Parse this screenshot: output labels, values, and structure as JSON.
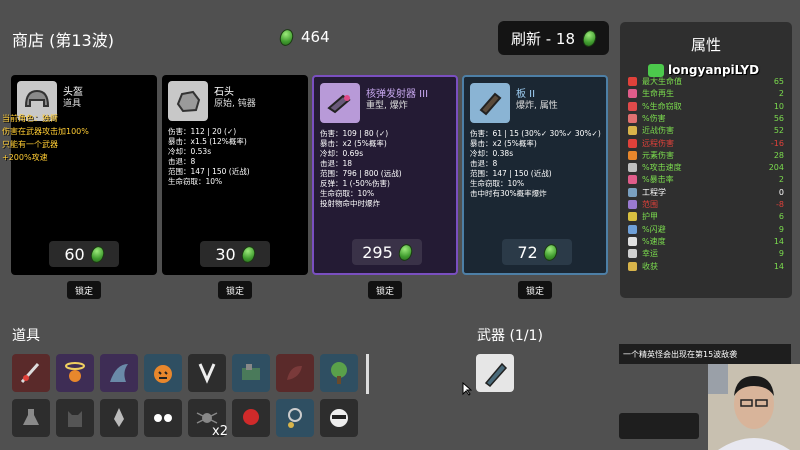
{
  "shop_title": "商店 (第13波)",
  "coins": "464",
  "refresh_label": "刷新 - 18",
  "cards": [
    {
      "name": "头盔",
      "type": "道具",
      "price": "60",
      "lock": "锁定",
      "stats": []
    },
    {
      "name": "石头",
      "type": "原始, 钝器",
      "price": "30",
      "lock": "锁定",
      "stats": [
        "伤害：112 | 20 (✓)",
        "暴击：x1.5 (12%概率)",
        "冷却：0.53s",
        "击退：8",
        "范围：147 | 150 (近战)",
        "生命窃取：10%"
      ]
    },
    {
      "name": "核弹发射器 III",
      "type": "重型, 爆炸",
      "price": "295",
      "lock": "锁定",
      "stats": [
        "伤害：109 | 80 (✓)",
        "暴击：x2 (5%概率)",
        "冷却：0.69s",
        "击退：18",
        "范围：796 | 800 (远战)",
        "反弹：1 (-50%伤害)",
        "生命窃取：10%",
        "投射物命中时爆炸"
      ]
    },
    {
      "name": "板 II",
      "type": "爆炸, 属性",
      "price": "72",
      "lock": "锁定",
      "stats": [
        "伤害：61 | 15 (30%✓ 30%✓ 30%✓)",
        "暴击：x2 (5%概率)",
        "冷却：0.38s",
        "击退：8",
        "范围：147 | 150 (近战)",
        "生命窃取：10%",
        "击中时有30%概率爆炸"
      ]
    }
  ],
  "items_title": "道具",
  "items_extra_count": "x2",
  "weapons_title": "武器 (1/1)",
  "attributes_title": "属性",
  "attributes": [
    {
      "label": "最大生命值",
      "value": "65",
      "color": "#e0413a",
      "lbl_color": "#7bdc4e"
    },
    {
      "label": "生命再生",
      "value": "2",
      "color": "#e05c8a",
      "lbl_color": "#7bdc4e"
    },
    {
      "label": "%生命窃取",
      "value": "10",
      "color": "#e04a4a",
      "lbl_color": "#7bdc4e"
    },
    {
      "label": "%伤害",
      "value": "56",
      "color": "#e07070",
      "lbl_color": "#7bdc4e"
    },
    {
      "label": "近战伤害",
      "value": "52",
      "color": "#d8b44a",
      "lbl_color": "#7bdc4e"
    },
    {
      "label": "远程伤害",
      "value": "-16",
      "color": "#e0413a",
      "lbl_color": "#e0413a"
    },
    {
      "label": "元素伤害",
      "value": "28",
      "color": "#e8872c",
      "lbl_color": "#7bdc4e"
    },
    {
      "label": "%攻击速度",
      "value": "204",
      "color": "#c0c0c0",
      "lbl_color": "#7bdc4e"
    },
    {
      "label": "%暴击率",
      "value": "2",
      "color": "#e05c8a",
      "lbl_color": "#7bdc4e"
    },
    {
      "label": "工程学",
      "value": "0",
      "color": "#7aa0c0",
      "lbl_color": "#ffffff"
    },
    {
      "label": "范围",
      "value": "-8",
      "color": "#9a7ad0",
      "lbl_color": "#e0413a"
    },
    {
      "label": "护甲",
      "value": "6",
      "color": "#d8c040",
      "lbl_color": "#7bdc4e"
    },
    {
      "label": "%闪避",
      "value": "9",
      "color": "#6fa0d8",
      "lbl_color": "#7bdc4e"
    },
    {
      "label": "%速度",
      "value": "14",
      "color": "#e0e0e0",
      "lbl_color": "#7bdc4e"
    },
    {
      "label": "幸运",
      "value": "9",
      "color": "#d0d0d0",
      "lbl_color": "#7bdc4e"
    },
    {
      "label": "收获",
      "value": "14",
      "color": "#d8b44a",
      "lbl_color": "#7bdc4e"
    }
  ],
  "stream_user": "longyanpiLYD",
  "danmaku": [
    "当前角色：独臂",
    "伤害在武器攻击加100%",
    "只能有一个武器",
    "+200%攻速"
  ],
  "notice": "一个精英怪会出现在第15波敌袭"
}
